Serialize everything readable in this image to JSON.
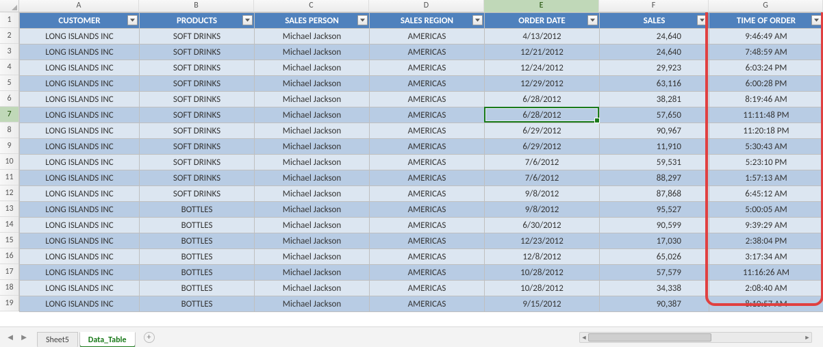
{
  "columns": {
    "letters": [
      "A",
      "B",
      "C",
      "D",
      "E",
      "F",
      "G"
    ],
    "widths": [
      175,
      168,
      168,
      168,
      168,
      160,
      167
    ],
    "active_index": 4,
    "headers": [
      "CUSTOMER",
      "PRODUCTS",
      "SALES PERSON",
      "SALES REGION",
      "ORDER DATE",
      "SALES",
      "TIME OF ORDER"
    ]
  },
  "active_cell": {
    "row_index": 5,
    "col_index": 4
  },
  "highlight_column_index": 6,
  "rows": [
    {
      "n": 1
    },
    {
      "n": 2,
      "customer": "LONG ISLANDS INC",
      "product": "SOFT DRINKS",
      "salesperson": "Michael Jackson",
      "region": "AMERICAS",
      "orderdate": "4/13/2012",
      "sales": "24,640",
      "time": "9:46:49 AM"
    },
    {
      "n": 3,
      "customer": "LONG ISLANDS INC",
      "product": "SOFT DRINKS",
      "salesperson": "Michael Jackson",
      "region": "AMERICAS",
      "orderdate": "12/21/2012",
      "sales": "24,640",
      "time": "7:48:59 AM"
    },
    {
      "n": 4,
      "customer": "LONG ISLANDS INC",
      "product": "SOFT DRINKS",
      "salesperson": "Michael Jackson",
      "region": "AMERICAS",
      "orderdate": "12/24/2012",
      "sales": "29,923",
      "time": "6:03:24 PM"
    },
    {
      "n": 5,
      "customer": "LONG ISLANDS INC",
      "product": "SOFT DRINKS",
      "salesperson": "Michael Jackson",
      "region": "AMERICAS",
      "orderdate": "12/29/2012",
      "sales": "63,116",
      "time": "6:00:28 PM"
    },
    {
      "n": 6,
      "customer": "LONG ISLANDS INC",
      "product": "SOFT DRINKS",
      "salesperson": "Michael Jackson",
      "region": "AMERICAS",
      "orderdate": "6/28/2012",
      "sales": "38,281",
      "time": "8:19:46 AM"
    },
    {
      "n": 7,
      "customer": "LONG ISLANDS INC",
      "product": "SOFT DRINKS",
      "salesperson": "Michael Jackson",
      "region": "AMERICAS",
      "orderdate": "6/28/2012",
      "sales": "57,650",
      "time": "11:11:48 PM"
    },
    {
      "n": 8,
      "customer": "LONG ISLANDS INC",
      "product": "SOFT DRINKS",
      "salesperson": "Michael Jackson",
      "region": "AMERICAS",
      "orderdate": "6/29/2012",
      "sales": "90,967",
      "time": "11:20:18 PM"
    },
    {
      "n": 9,
      "customer": "LONG ISLANDS INC",
      "product": "SOFT DRINKS",
      "salesperson": "Michael Jackson",
      "region": "AMERICAS",
      "orderdate": "6/29/2012",
      "sales": "11,910",
      "time": "5:30:43 AM"
    },
    {
      "n": 10,
      "customer": "LONG ISLANDS INC",
      "product": "SOFT DRINKS",
      "salesperson": "Michael Jackson",
      "region": "AMERICAS",
      "orderdate": "7/6/2012",
      "sales": "59,531",
      "time": "5:23:10 PM"
    },
    {
      "n": 11,
      "customer": "LONG ISLANDS INC",
      "product": "SOFT DRINKS",
      "salesperson": "Michael Jackson",
      "region": "AMERICAS",
      "orderdate": "7/6/2012",
      "sales": "88,297",
      "time": "1:57:13 AM"
    },
    {
      "n": 12,
      "customer": "LONG ISLANDS INC",
      "product": "SOFT DRINKS",
      "salesperson": "Michael Jackson",
      "region": "AMERICAS",
      "orderdate": "9/8/2012",
      "sales": "87,868",
      "time": "6:45:12 AM"
    },
    {
      "n": 13,
      "customer": "LONG ISLANDS INC",
      "product": "BOTTLES",
      "salesperson": "Michael Jackson",
      "region": "AMERICAS",
      "orderdate": "9/8/2012",
      "sales": "95,527",
      "time": "5:00:05 AM"
    },
    {
      "n": 14,
      "customer": "LONG ISLANDS INC",
      "product": "BOTTLES",
      "salesperson": "Michael Jackson",
      "region": "AMERICAS",
      "orderdate": "6/30/2012",
      "sales": "90,599",
      "time": "9:39:29 AM"
    },
    {
      "n": 15,
      "customer": "LONG ISLANDS INC",
      "product": "BOTTLES",
      "salesperson": "Michael Jackson",
      "region": "AMERICAS",
      "orderdate": "12/23/2012",
      "sales": "17,030",
      "time": "2:38:04 PM"
    },
    {
      "n": 16,
      "customer": "LONG ISLANDS INC",
      "product": "BOTTLES",
      "salesperson": "Michael Jackson",
      "region": "AMERICAS",
      "orderdate": "12/8/2012",
      "sales": "65,026",
      "time": "3:17:34 AM"
    },
    {
      "n": 17,
      "customer": "LONG ISLANDS INC",
      "product": "BOTTLES",
      "salesperson": "Michael Jackson",
      "region": "AMERICAS",
      "orderdate": "10/28/2012",
      "sales": "57,579",
      "time": "11:16:26 AM"
    },
    {
      "n": 18,
      "customer": "LONG ISLANDS INC",
      "product": "BOTTLES",
      "salesperson": "Michael Jackson",
      "region": "AMERICAS",
      "orderdate": "10/28/2012",
      "sales": "34,338",
      "time": "2:08:40 AM"
    },
    {
      "n": 19,
      "customer": "LONG ISLANDS INC",
      "product": "BOTTLES",
      "salesperson": "Michael Jackson",
      "region": "AMERICAS",
      "orderdate": "9/15/2012",
      "sales": "90,387",
      "time": "8:10:57 AM"
    }
  ],
  "sheet_tabs": {
    "tabs": [
      "Sheet5",
      "Data_Table"
    ],
    "active_index": 1
  }
}
